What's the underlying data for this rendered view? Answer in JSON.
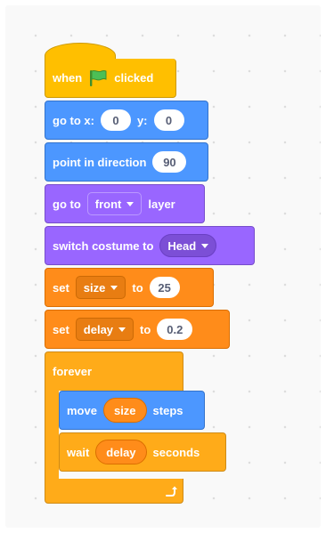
{
  "script": {
    "hat": {
      "when": "when",
      "icon": "green-flag-icon",
      "clicked": "clicked"
    },
    "goto_xy": {
      "label": "go to x:",
      "x": "0",
      "y_label": "y:",
      "y": "0"
    },
    "point_direction": {
      "label": "point in direction",
      "value": "90"
    },
    "go_to_layer": {
      "label": "go to",
      "option": "front",
      "suffix": "layer"
    },
    "switch_costume": {
      "label": "switch costume to",
      "option": "Head"
    },
    "set_size": {
      "label": "set",
      "variable": "size",
      "to": "to",
      "value": "25"
    },
    "set_delay": {
      "label": "set",
      "variable": "delay",
      "to": "to",
      "value": "0.2"
    },
    "forever": {
      "label": "forever",
      "loop_icon": "loop-arrow-icon"
    },
    "move": {
      "label": "move",
      "reporter": "size",
      "suffix": "steps"
    },
    "wait": {
      "label": "wait",
      "reporter": "delay",
      "suffix": "seconds"
    }
  },
  "colors": {
    "events": "#ffbf00",
    "motion": "#4c97ff",
    "looks": "#9966ff",
    "variables": "#ff8c1a",
    "control": "#ffab19",
    "background": "#f9f9f9"
  }
}
